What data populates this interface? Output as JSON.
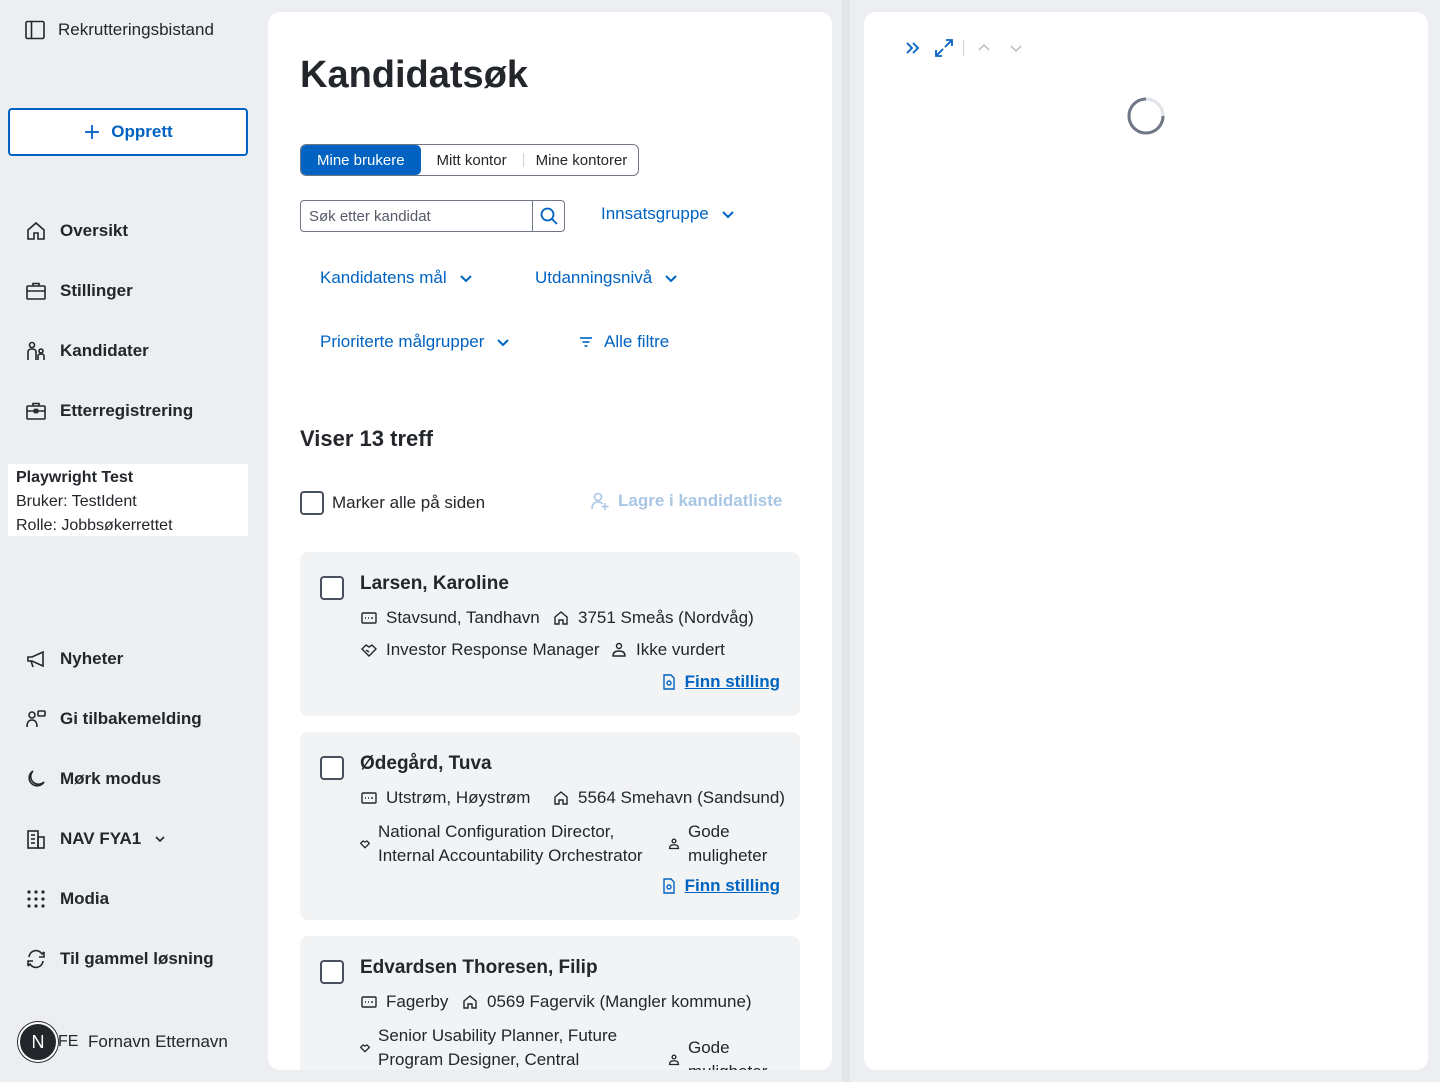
{
  "sidebar": {
    "brand": "Rekrutteringsbistand",
    "create_label": "Opprett",
    "nav_top": [
      {
        "label": "Oversikt",
        "icon": "house-icon"
      },
      {
        "label": "Stillinger",
        "icon": "briefcase-icon"
      },
      {
        "label": "Kandidater",
        "icon": "people-icon"
      },
      {
        "label": "Etterregistrering",
        "icon": "briefcase-clock-icon"
      }
    ],
    "user": {
      "name": "Playwright Test",
      "bruker": "Bruker: TestIdent",
      "rolle": "Rolle: Jobbsøkerrettet"
    },
    "nav_bottom": [
      {
        "label": "Nyheter",
        "icon": "megaphone-icon"
      },
      {
        "label": "Gi tilbakemelding",
        "icon": "person-chat-icon"
      },
      {
        "label": "Mørk modus",
        "icon": "moon-icon"
      },
      {
        "label": "NAV FYA1",
        "icon": "buildings-icon"
      },
      {
        "label": "Modia",
        "icon": "menu-grid-icon"
      },
      {
        "label": "Til gammel løsning",
        "icon": "arrows-circle-icon"
      }
    ],
    "profile": {
      "badge": "N",
      "initials": "FE",
      "name": "Fornavn Etternavn"
    }
  },
  "main": {
    "title": "Kandidatsøk",
    "toggle": [
      "Mine brukere",
      "Mitt kontor",
      "Mine kontorer"
    ],
    "search_placeholder": "Søk etter kandidat",
    "filters": {
      "innsatsgruppe": "Innsatsgruppe",
      "maal": "Kandidatens mål",
      "utdanning": "Utdanningsnivå",
      "malgrupper": "Prioriterte målgrupper",
      "alle": "Alle filtre"
    },
    "results_title": "Viser 13 treff",
    "select_all": "Marker alle på siden",
    "save_list": "Lagre i kandidatliste",
    "find_label": "Finn stilling",
    "candidates": [
      {
        "name": "Larsen, Karoline",
        "place": "Stavsund, Tandhavn",
        "address": "3751 Smeås (Nordvåg)",
        "job": "Investor Response Manager",
        "status": "Ikke vurdert"
      },
      {
        "name": "Ødegård, Tuva",
        "place": "Utstrøm, Høystrøm",
        "address": "5564 Smehavn (Sandsund)",
        "job": "National Configuration Director, Internal Accountability Orchestrator",
        "status": "Gode muligheter"
      },
      {
        "name": "Edvardsen Thoresen, Filip",
        "place": "Fagerby",
        "address": "0569 Fagervik (Mangler kommune)",
        "job": "Senior Usability Planner, Future Program Designer, Central",
        "status": "Gode muligheter"
      }
    ]
  },
  "colors": {
    "accent": "#0063c1",
    "text": "#23262a",
    "background": "#eceef1",
    "card": "#f2f3f5"
  }
}
